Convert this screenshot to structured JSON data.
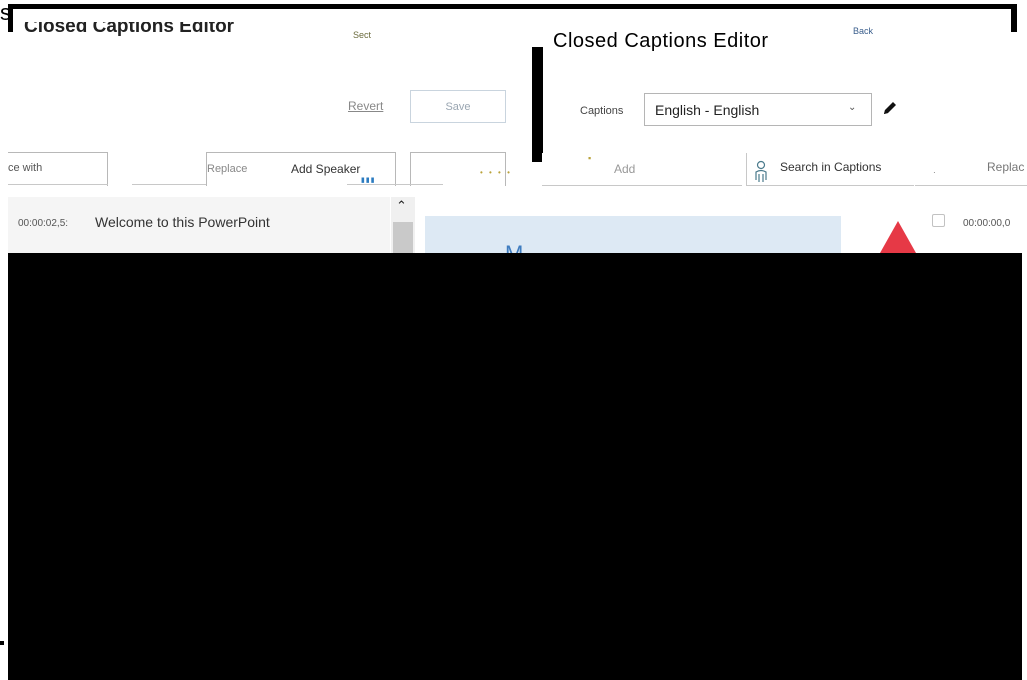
{
  "top": {
    "stray_glyph": "s"
  },
  "left_panel": {
    "title": "Closed Captions Editor",
    "title_accent": "Sect",
    "revert_label": "Revert",
    "save_label": "Save",
    "find_placeholder": "ce with",
    "replace_label": "Replace",
    "add_speaker_label": "Add Speaker",
    "captions": [
      {
        "time": "00:00:02,5:",
        "text": "Welcome to this PowerPoint"
      }
    ]
  },
  "right_panel": {
    "title": "Closed Captions Editor",
    "back_link": "Back",
    "captions_label": "Captions",
    "language_selected": "English - English",
    "add_label": "Add",
    "search_label": "Search in Captions",
    "replace_label": "Replac",
    "preview_text": "M",
    "captions": [
      {
        "time": "00:00:00,0"
      }
    ]
  },
  "colors": {
    "accent_blue": "#3e7cbf",
    "preview_bg": "#dde9f4",
    "alert_red": "#e63946"
  },
  "icons": [
    "chevron-down-icon",
    "pencil-icon",
    "person-search-icon",
    "alert-triangle-icon",
    "scroll-up-icon"
  ]
}
